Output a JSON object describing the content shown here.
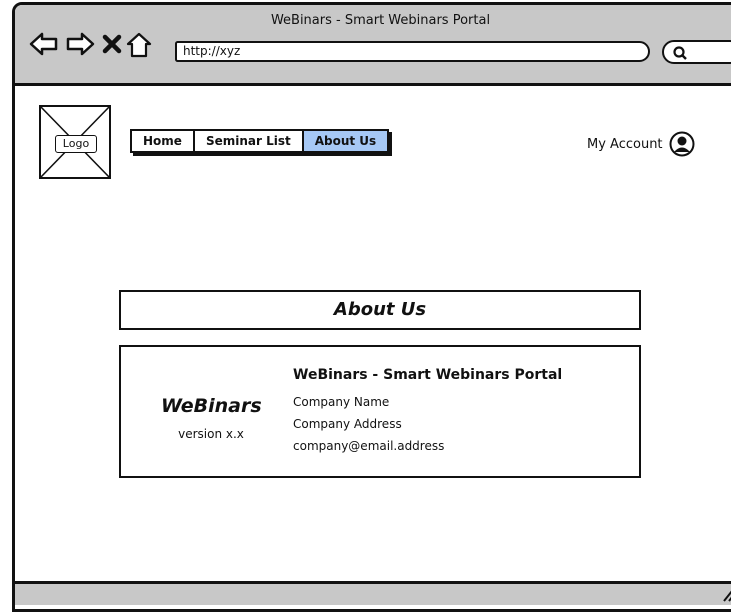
{
  "window": {
    "title": "WeBinars - Smart Webinars Portal"
  },
  "browser": {
    "url": "http://xyz",
    "icons": [
      "back-arrow-icon",
      "forward-arrow-icon",
      "close-icon",
      "home-icon",
      "search-icon"
    ]
  },
  "header": {
    "logo_label": "Logo",
    "nav_tabs": [
      {
        "label": "Home"
      },
      {
        "label": "Seminar List"
      },
      {
        "label": "About Us",
        "active": true
      }
    ],
    "account_label": "My Account",
    "active_tab_color": "#a6c8f5"
  },
  "about": {
    "heading": "About Us",
    "brand": "WeBinars",
    "version": "version x.x",
    "title": "WeBinars - Smart Webinars Portal",
    "company_name": "Company Name",
    "company_address": "Company Address",
    "company_email": "company@email.address"
  }
}
